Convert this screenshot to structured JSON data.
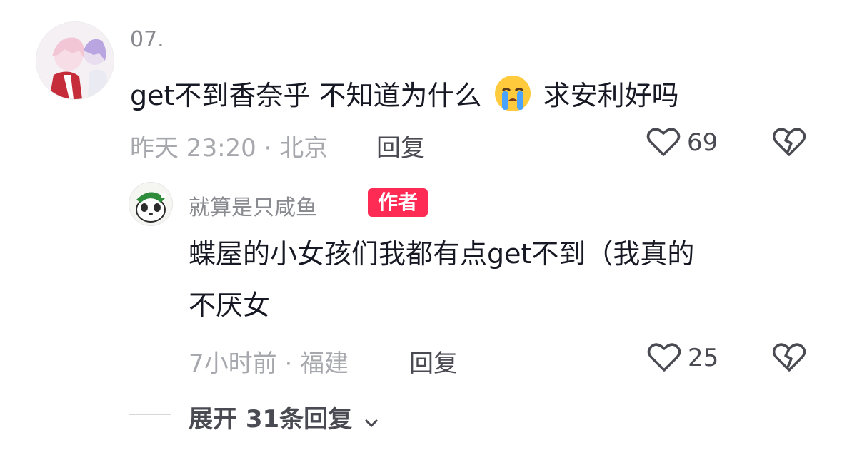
{
  "comment": {
    "username": "07.",
    "text_before_emoji": "get不到香奈乎 不知道为什么",
    "emoji": "loudly-crying-emoji",
    "text_after_emoji": "求安利好吗",
    "meta": "昨天 23:20 · 北京",
    "reply_label": "回复",
    "like_count": "69"
  },
  "reply": {
    "username": "就算是只咸鱼",
    "badge": "作者",
    "text_line1": "蝶屋的小女孩们我都有点get不到（我真的",
    "text_line2": "不厌女",
    "meta": "7小时前 · 福建",
    "reply_label": "回复",
    "like_count": "25"
  },
  "expand": {
    "label": "展开 31条回复"
  },
  "colors": {
    "badge": "#fe2c55",
    "primary_text": "#161823",
    "secondary_text": "#a7a8ad"
  }
}
